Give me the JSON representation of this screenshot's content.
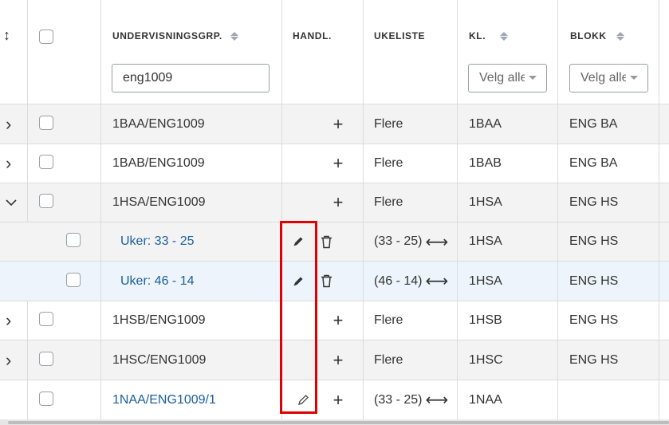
{
  "header": {
    "columns": {
      "undervisningsgrp": "UNDERVISNINGSGRP.",
      "handl": "HANDL.",
      "ukeliste": "UKELISTE",
      "kl": "KL.",
      "blokk": "BLOKK"
    },
    "filters": {
      "undervisningsgrp_value": "eng1009",
      "kl_placeholder": "Velg alle",
      "blokk_placeholder": "Velg alle"
    },
    "expand_sort_glyph": "↕"
  },
  "rows": [
    {
      "type": "group",
      "expand": "›",
      "name": "1BAA/ENG1009",
      "ukeliste": "Flere",
      "kl": "1BAA",
      "blokk": "ENG BA"
    },
    {
      "type": "group",
      "expand": "›",
      "name": "1BAB/ENG1009",
      "ukeliste": "Flere",
      "kl": "1BAB",
      "blokk": "ENG BA"
    },
    {
      "type": "group",
      "expand": "⌄",
      "name": "1HSA/ENG1009",
      "ukeliste": "Flere",
      "kl": "1HSA",
      "blokk": "ENG HS"
    },
    {
      "type": "child",
      "name": "Uker: 33 - 25",
      "ukeliste": "(33 - 25)",
      "kl": "1HSA",
      "blokk": "ENG HS"
    },
    {
      "type": "child",
      "name": "Uker: 46 - 14",
      "ukeliste": "(46 - 14)",
      "kl": "1HSA",
      "blokk": "ENG HS"
    },
    {
      "type": "group",
      "expand": "›",
      "name": "1HSB/ENG1009",
      "ukeliste": "Flere",
      "kl": "1HSB",
      "blokk": "ENG HS"
    },
    {
      "type": "group",
      "expand": "›",
      "name": "1HSC/ENG1009",
      "ukeliste": "Flere",
      "kl": "1HSC",
      "blokk": "ENG HS"
    },
    {
      "type": "single",
      "name": "1NAA/ENG1009/1",
      "ukeliste": "(33 - 25)",
      "kl": "1NAA",
      "blokk": ""
    }
  ],
  "icons": {
    "plus": "+",
    "swap_arrow": "⟷",
    "edit": "pencil-icon",
    "delete": "trash-icon"
  },
  "colors": {
    "link": "#1a5f9e",
    "row_gray": "#f3f3f3",
    "row_highlight": "#edf4fb",
    "annotation_box": "#e00000"
  }
}
